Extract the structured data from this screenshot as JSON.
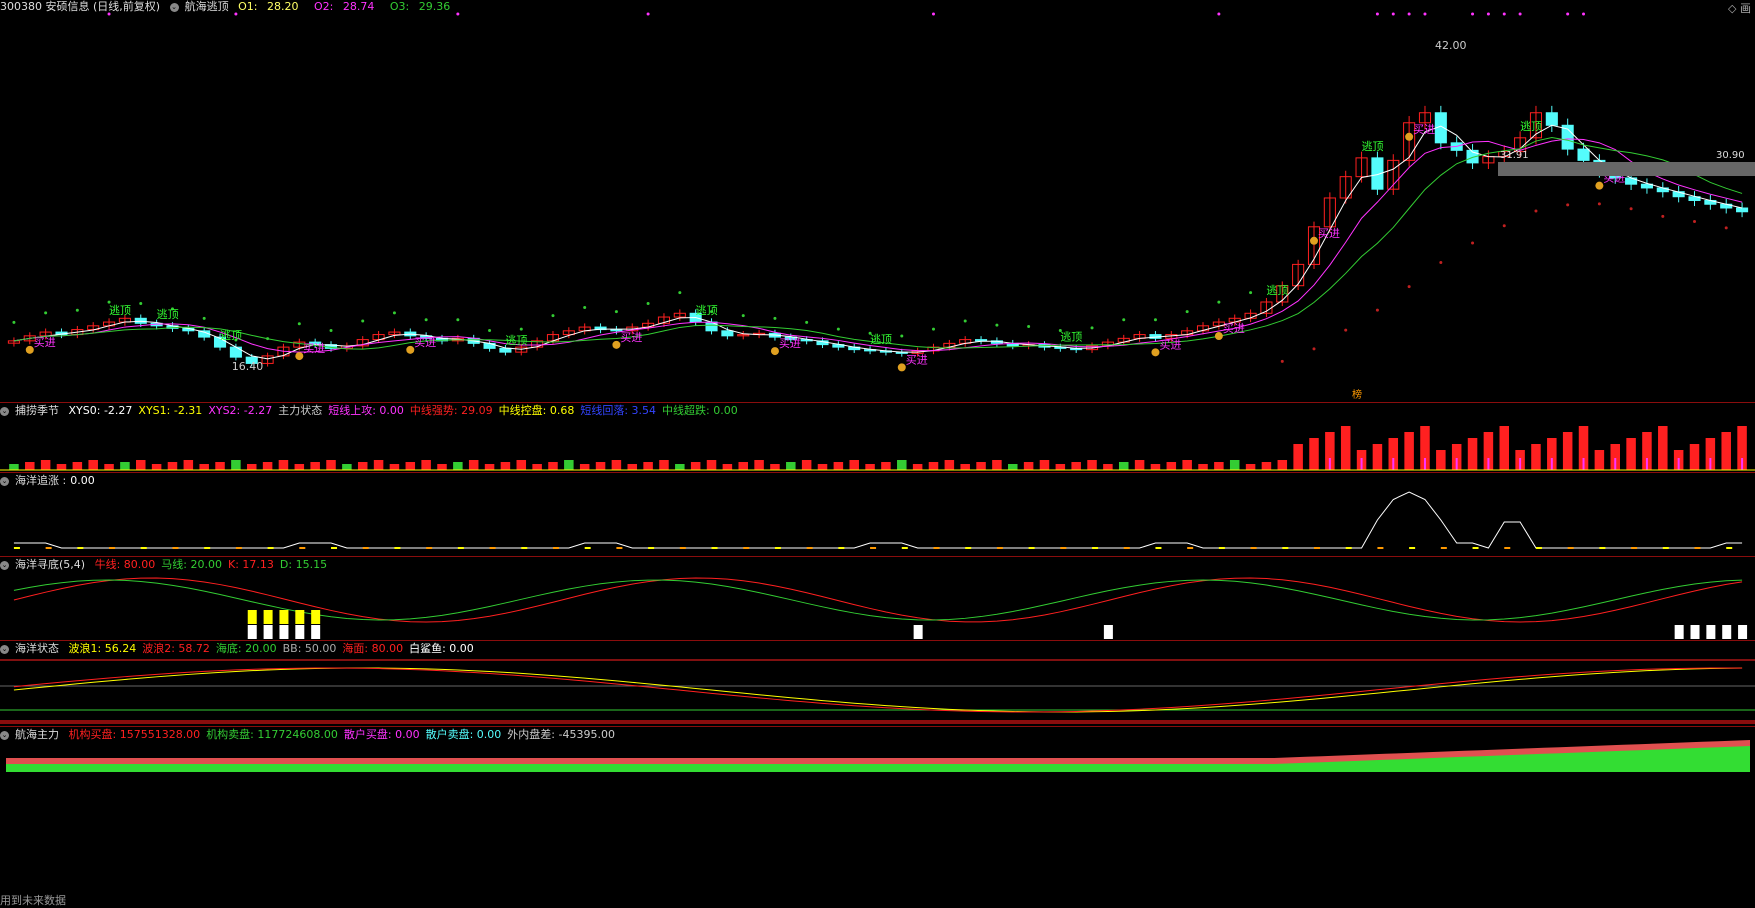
{
  "colors": {
    "white": "#ffffff",
    "yellow": "#ffff00",
    "magenta": "#ff33ff",
    "green": "#33cc33",
    "red": "#ff2020",
    "cyan": "#54fcfc",
    "blue": "#3344ff",
    "orange": "#ff9900",
    "gray": "#aaaaaa"
  },
  "main": {
    "stock": "300380 安硕信息 (日线,前复权)",
    "indicator": "航海逃顶",
    "o1_label": "O1:",
    "o1": "28.20",
    "o2_label": "O2:",
    "o2": "28.74",
    "o3_label": "O3:",
    "o3": "29.36",
    "high_label": "42.00",
    "low_label": "16.40",
    "price_right_1": "31.91",
    "price_right_2": "30.90",
    "sell_tag": "逃顶",
    "buy_tag": "买进",
    "bang_tag": "榜",
    "corner": "◇ 画"
  },
  "p1": {
    "name": "捕捞季节",
    "items": [
      {
        "k": "XYS0:",
        "v": "-2.27",
        "c": "#ffffff"
      },
      {
        "k": "XYS1:",
        "v": "-2.31",
        "c": "#ffff00"
      },
      {
        "k": "XYS2:",
        "v": "-2.27",
        "c": "#ff33ff"
      },
      {
        "k": "主力状态",
        "v": "",
        "c": "#cccccc"
      },
      {
        "k": "短线上攻:",
        "v": "0.00",
        "c": "#ff33ff"
      },
      {
        "k": "中线强势:",
        "v": "29.09",
        "c": "#ff2020"
      },
      {
        "k": "中线控盘:",
        "v": "0.68",
        "c": "#ffff00"
      },
      {
        "k": "短线回落:",
        "v": "3.54",
        "c": "#3344ff"
      },
      {
        "k": "中线超跌:",
        "v": "0.00",
        "c": "#33cc33"
      }
    ]
  },
  "p2": {
    "name": "海洋追涨 :",
    "value": "0.00"
  },
  "p3": {
    "name": "海洋寻底(5,4)",
    "items": [
      {
        "k": "牛线:",
        "v": "80.00",
        "c": "#ff2020"
      },
      {
        "k": "马线:",
        "v": "20.00",
        "c": "#33cc33"
      },
      {
        "k": "K:",
        "v": "17.13",
        "c": "#ff2020"
      },
      {
        "k": "D:",
        "v": "15.15",
        "c": "#33cc33"
      }
    ]
  },
  "p4": {
    "name": "海洋状态",
    "items": [
      {
        "k": "波浪1:",
        "v": "56.24",
        "c": "#ffff00"
      },
      {
        "k": "波浪2:",
        "v": "58.72",
        "c": "#ff2020"
      },
      {
        "k": "海底:",
        "v": "20.00",
        "c": "#33cc33"
      },
      {
        "k": "BB:",
        "v": "50.00",
        "c": "#aaaaaa"
      },
      {
        "k": "海面:",
        "v": "80.00",
        "c": "#ff2020"
      },
      {
        "k": "白鲨鱼:",
        "v": "0.00",
        "c": "#ffffff"
      }
    ]
  },
  "p5": {
    "name": "航海主力",
    "items": [
      {
        "k": "机构买盘:",
        "v": "157551328.00",
        "c": "#ff2020"
      },
      {
        "k": "机构卖盘:",
        "v": "117724608.00",
        "c": "#33cc33"
      },
      {
        "k": "散户买盘:",
        "v": "0.00",
        "c": "#ff33ff"
      },
      {
        "k": "散户卖盘:",
        "v": "0.00",
        "c": "#54fcfc"
      },
      {
        "k": "外内盘差:",
        "v": "-45395.00",
        "c": "#cccccc"
      }
    ]
  },
  "footer": "用到未来数据",
  "chart_data": {
    "type": "line",
    "title": "300380 安硕信息 (日线,前复权)",
    "x_count": 110,
    "close": [
      18.4,
      18.8,
      19.1,
      18.9,
      19.3,
      19.6,
      19.9,
      20.2,
      19.8,
      19.6,
      19.4,
      19.2,
      18.7,
      17.9,
      17.1,
      16.6,
      17.2,
      17.9,
      18.3,
      18.1,
      17.8,
      18.0,
      18.5,
      18.9,
      19.1,
      18.8,
      18.6,
      18.4,
      18.6,
      18.2,
      17.8,
      17.5,
      17.9,
      18.4,
      18.9,
      19.2,
      19.5,
      19.3,
      19.2,
      19.5,
      19.8,
      20.3,
      20.6,
      19.9,
      19.2,
      18.8,
      18.9,
      19.0,
      18.7,
      18.5,
      18.4,
      18.1,
      17.9,
      17.7,
      17.6,
      17.5,
      17.4,
      17.6,
      17.9,
      18.2,
      18.5,
      18.4,
      18.2,
      18.0,
      18.1,
      17.9,
      17.8,
      17.7,
      18.0,
      18.3,
      18.6,
      18.9,
      18.6,
      18.9,
      19.2,
      19.6,
      19.9,
      20.2,
      20.6,
      21.5,
      22.8,
      24.5,
      27.5,
      29.8,
      31.5,
      33.0,
      30.5,
      32.8,
      35.8,
      36.6,
      34.2,
      33.6,
      32.6,
      33.1,
      33.5,
      34.6,
      36.6,
      35.6,
      33.7,
      32.8,
      31.9,
      31.4,
      30.9,
      30.6,
      30.3,
      29.9,
      29.6,
      29.3,
      29.0,
      28.7
    ],
    "high_price": 42.0,
    "low_price": 16.4,
    "ylim": [
      14,
      44
    ],
    "series_names": [
      "O1",
      "O2",
      "O3"
    ],
    "last_values": {
      "O1": 28.2,
      "O2": 28.74,
      "O3": 29.36
    }
  }
}
